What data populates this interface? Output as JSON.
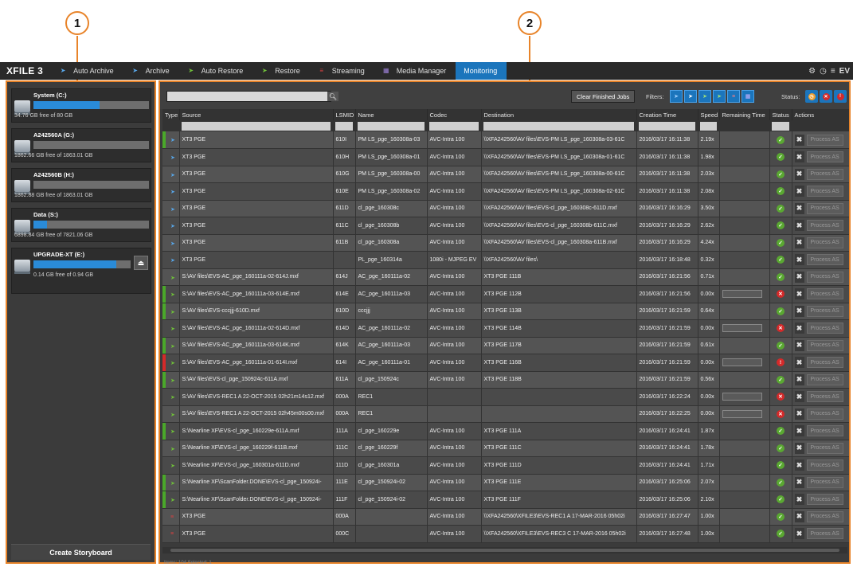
{
  "callouts": [
    "1",
    "2"
  ],
  "app": {
    "logo": "XFILE 3"
  },
  "menu": [
    {
      "label": "Auto Archive",
      "icon": "auto-archive-icon",
      "color": "#58a6e8"
    },
    {
      "label": "Archive",
      "icon": "archive-icon",
      "color": "#58a6e8"
    },
    {
      "label": "Auto Restore",
      "icon": "auto-restore-icon",
      "color": "#6fbf3a"
    },
    {
      "label": "Restore",
      "icon": "restore-icon",
      "color": "#6fbf3a"
    },
    {
      "label": "Streaming",
      "icon": "streaming-icon",
      "color": "#d94141"
    },
    {
      "label": "Media Manager",
      "icon": "media-manager-icon",
      "color": "#9b7fd6"
    },
    {
      "label": "Monitoring",
      "icon": "",
      "color": "",
      "active": true
    }
  ],
  "top_right": {
    "brand": "EV"
  },
  "drives": [
    {
      "name": "System (C:)",
      "free": "34.76 GB free of 80 GB",
      "used_fraction": 0.57
    },
    {
      "name": "A242560A (G:)",
      "free": "1862.66 GB free of 1863.01 GB",
      "used_fraction": 0.0
    },
    {
      "name": "A242560B (H:)",
      "free": "1862.88 GB free of 1863.01 GB",
      "used_fraction": 0.0
    },
    {
      "name": "Data (S:)",
      "free": "6898.84 GB free of 7821.06 GB",
      "used_fraction": 0.12
    },
    {
      "name": "UPGRADE-XT (E:)",
      "free": "0.14 GB free of 0.94 GB",
      "used_fraction": 0.85,
      "removable": true
    }
  ],
  "storyboard_label": "Create Storyboard",
  "toolbar": {
    "clear_label": "Clear Finished Jobs",
    "filters_label": "Filters:",
    "status_label": "Status:",
    "search_placeholder": ""
  },
  "columns": [
    "Type",
    "Source",
    "LSMID",
    "Name",
    "Codec",
    "Destination",
    "Creation Time",
    "Speed",
    "Remaining Time",
    "Status",
    "Actions"
  ],
  "action_label": "Process AS",
  "rows": [
    {
      "stripe": "#4aa82a",
      "type": "auto-archive",
      "source": "XT3 PGE",
      "lsmid": "610I",
      "name": "PM LS_pge_160308a-03",
      "codec": "AVC-Intra 100",
      "dest": "\\\\XFA242560\\AV files\\EVS-PM LS_pge_160308a-03-61C",
      "time": "2016/03/17 16:11:38",
      "speed": "2.19x",
      "rem": false,
      "status": "ok"
    },
    {
      "stripe": "",
      "type": "auto-archive",
      "source": "XT3 PGE",
      "lsmid": "610H",
      "name": "PM LS_pge_160308a-01",
      "codec": "AVC-Intra 100",
      "dest": "\\\\XFA242560\\AV files\\EVS-PM LS_pge_160308a-01-61C",
      "time": "2016/03/17 16:11:38",
      "speed": "1.98x",
      "rem": false,
      "status": "ok"
    },
    {
      "stripe": "",
      "type": "auto-archive",
      "source": "XT3 PGE",
      "lsmid": "610G",
      "name": "PM LS_pge_160308a-00",
      "codec": "AVC-Intra 100",
      "dest": "\\\\XFA242560\\AV files\\EVS-PM LS_pge_160308a-00-61C",
      "time": "2016/03/17 16:11:38",
      "speed": "2.03x",
      "rem": false,
      "status": "ok"
    },
    {
      "stripe": "",
      "type": "auto-archive",
      "source": "XT3 PGE",
      "lsmid": "610E",
      "name": "PM LS_pge_160308a-02",
      "codec": "AVC-Intra 100",
      "dest": "\\\\XFA242560\\AV files\\EVS-PM LS_pge_160308a-02-61C",
      "time": "2016/03/17 16:11:38",
      "speed": "2.08x",
      "rem": false,
      "status": "ok"
    },
    {
      "stripe": "",
      "type": "archive",
      "source": "XT3 PGE",
      "lsmid": "611D",
      "name": "cl_pge_160308c",
      "codec": "AVC-Intra 100",
      "dest": "\\\\XFA242560\\AV files\\EVS-cl_pge_160308c-611D.mxf",
      "time": "2016/03/17 16:16:29",
      "speed": "3.50x",
      "rem": false,
      "status": "ok"
    },
    {
      "stripe": "",
      "type": "archive",
      "source": "XT3 PGE",
      "lsmid": "611C",
      "name": "cl_pge_160308b",
      "codec": "AVC-Intra 100",
      "dest": "\\\\XFA242560\\AV files\\EVS-cl_pge_160308b-611C.mxf",
      "time": "2016/03/17 16:16:29",
      "speed": "2.62x",
      "rem": false,
      "status": "ok"
    },
    {
      "stripe": "",
      "type": "archive",
      "source": "XT3 PGE",
      "lsmid": "611B",
      "name": "cl_pge_160308a",
      "codec": "AVC-Intra 100",
      "dest": "\\\\XFA242560\\AV files\\EVS-cl_pge_160308a-611B.mxf",
      "time": "2016/03/17 16:16:29",
      "speed": "4.24x",
      "rem": false,
      "status": "ok"
    },
    {
      "stripe": "",
      "type": "archive",
      "source": "XT3 PGE",
      "lsmid": "",
      "name": "PL_pge_160314a",
      "codec": "1080i - MJPEG EV",
      "dest": "\\\\XFA242560\\AV files\\",
      "time": "2016/03/17 16:18:48",
      "speed": "0.32x",
      "rem": false,
      "status": "ok"
    },
    {
      "stripe": "",
      "type": "auto-restore",
      "source": "S:\\AV files\\EVS-AC_pge_160111a-02-614J.mxf",
      "lsmid": "614J",
      "name": "AC_pge_160111a-02",
      "codec": "AVC-Intra 100",
      "dest": "XT3 PGE  111B",
      "time": "2016/03/17 16:21:56",
      "speed": "0.71x",
      "rem": false,
      "status": "ok"
    },
    {
      "stripe": "#4aa82a",
      "type": "auto-restore",
      "source": "S:\\AV files\\EVS-AC_pge_160111a-03-614E.mxf",
      "lsmid": "614E",
      "name": "AC_pge_160111a-03",
      "codec": "AVC-Intra 100",
      "dest": "XT3 PGE  112B",
      "time": "2016/03/17 16:21:56",
      "speed": "0.00x",
      "rem": true,
      "status": "error"
    },
    {
      "stripe": "#4aa82a",
      "type": "auto-restore",
      "source": "S:\\AV files\\EVS-cccjjj-610D.mxf",
      "lsmid": "610D",
      "name": "cccjjj",
      "codec": "AVC-Intra 100",
      "dest": "XT3 PGE  113B",
      "time": "2016/03/17 16:21:59",
      "speed": "0.64x",
      "rem": false,
      "status": "ok"
    },
    {
      "stripe": "",
      "type": "auto-restore",
      "source": "S:\\AV files\\EVS-AC_pge_160111a-02-614D.mxf",
      "lsmid": "614D",
      "name": "AC_pge_160111a-02",
      "codec": "AVC-Intra 100",
      "dest": "XT3 PGE  114B",
      "time": "2016/03/17 16:21:59",
      "speed": "0.00x",
      "rem": true,
      "status": "error"
    },
    {
      "stripe": "#4aa82a",
      "type": "auto-restore",
      "source": "S:\\AV files\\EVS-AC_pge_160111a-03-614K.mxf",
      "lsmid": "614K",
      "name": "AC_pge_160111a-03",
      "codec": "AVC-Intra 100",
      "dest": "XT3 PGE  117B",
      "time": "2016/03/17 16:21:59",
      "speed": "0.61x",
      "rem": false,
      "status": "ok"
    },
    {
      "stripe": "#d42a2a",
      "type": "auto-restore",
      "source": "S:\\AV files\\EVS-AC_pge_160111a-01-614I.mxf",
      "lsmid": "614I",
      "name": "AC_pge_160111a-01",
      "codec": "AVC-Intra 100",
      "dest": "XT3 PGE  116B",
      "time": "2016/03/17 16:21:59",
      "speed": "0.00x",
      "rem": true,
      "status": "warn"
    },
    {
      "stripe": "#4aa82a",
      "type": "auto-restore",
      "source": "S:\\AV files\\EVS-cl_pge_150924c-611A.mxf",
      "lsmid": "611A",
      "name": "cl_pge_150924c",
      "codec": "AVC-Intra 100",
      "dest": "XT3 PGE  118B",
      "time": "2016/03/17 16:21:59",
      "speed": "0.56x",
      "rem": false,
      "status": "ok"
    },
    {
      "stripe": "",
      "type": "auto-restore",
      "source": "S:\\AV files\\EVS-REC1 A 22-OCT-2015 02h21m14s12.mxf",
      "lsmid": "000A",
      "name": "REC1",
      "codec": "",
      "dest": "",
      "time": "2016/03/17 16:22:24",
      "speed": "0.00x",
      "rem": true,
      "status": "error"
    },
    {
      "stripe": "",
      "type": "auto-restore",
      "source": "S:\\AV files\\EVS-REC1 A 22-OCT-2015 02h45m00s00.mxf",
      "lsmid": "000A",
      "name": "REC1",
      "codec": "",
      "dest": "",
      "time": "2016/03/17 16:22:25",
      "speed": "0.00x",
      "rem": true,
      "status": "error"
    },
    {
      "stripe": "#4aa82a",
      "type": "restore",
      "source": "S:\\Nearline XF\\EVS-cl_pge_160229e-611A.mxf",
      "lsmid": "111A",
      "name": "cl_pge_160229e",
      "codec": "AVC-Intra 100",
      "dest": "XT3 PGE  111A",
      "time": "2016/03/17 16:24:41",
      "speed": "1.87x",
      "rem": false,
      "status": "ok"
    },
    {
      "stripe": "",
      "type": "restore",
      "source": "S:\\Nearline XF\\EVS-cl_pge_160229f-611B.mxf",
      "lsmid": "111C",
      "name": "cl_pge_160229f",
      "codec": "AVC-Intra 100",
      "dest": "XT3 PGE  111C",
      "time": "2016/03/17 16:24:41",
      "speed": "1.78x",
      "rem": false,
      "status": "ok"
    },
    {
      "stripe": "",
      "type": "restore",
      "source": "S:\\Nearline XF\\EVS-cl_pge_160301a-611D.mxf",
      "lsmid": "111D",
      "name": "cl_pge_160301a",
      "codec": "AVC-Intra 100",
      "dest": "XT3 PGE  111D",
      "time": "2016/03/17 16:24:41",
      "speed": "1.71x",
      "rem": false,
      "status": "ok"
    },
    {
      "stripe": "#4aa82a",
      "type": "restore",
      "source": "S:\\Nearline XF\\ScanFolder.DONE\\EVS-cl_pge_150924i-",
      "lsmid": "111E",
      "name": "cl_pge_150924i-02",
      "codec": "AVC-Intra 100",
      "dest": "XT3 PGE  111E",
      "time": "2016/03/17 16:25:06",
      "speed": "2.07x",
      "rem": false,
      "status": "ok"
    },
    {
      "stripe": "#4aa82a",
      "type": "restore",
      "source": "S:\\Nearline XF\\ScanFolder.DONE\\EVS-cl_pge_150924i-",
      "lsmid": "111F",
      "name": "cl_pge_150924i-02",
      "codec": "AVC-Intra 100",
      "dest": "XT3 PGE  111F",
      "time": "2016/03/17 16:25:06",
      "speed": "2.10x",
      "rem": false,
      "status": "ok"
    },
    {
      "stripe": "",
      "type": "streaming",
      "source": "XT3 PGE",
      "lsmid": "000A",
      "name": "",
      "codec": "AVC-Intra 100",
      "dest": "\\\\XFA242560\\XFILE3\\EVS-REC1 A 17-MAR-2016 05h02i",
      "time": "2016/03/17 16:27:47",
      "speed": "1.00x",
      "rem": false,
      "status": "ok"
    },
    {
      "stripe": "",
      "type": "streaming",
      "source": "XT3 PGE",
      "lsmid": "000C",
      "name": "",
      "codec": "AVC-Intra 100",
      "dest": "\\\\XFA242560\\XFILE3\\EVS-REC3 C 17-MAR-2016 05h02i",
      "time": "2016/03/17 16:27:48",
      "speed": "1.00x",
      "rem": false,
      "status": "ok"
    }
  ],
  "footer": "Items: 104     Selected: 1"
}
